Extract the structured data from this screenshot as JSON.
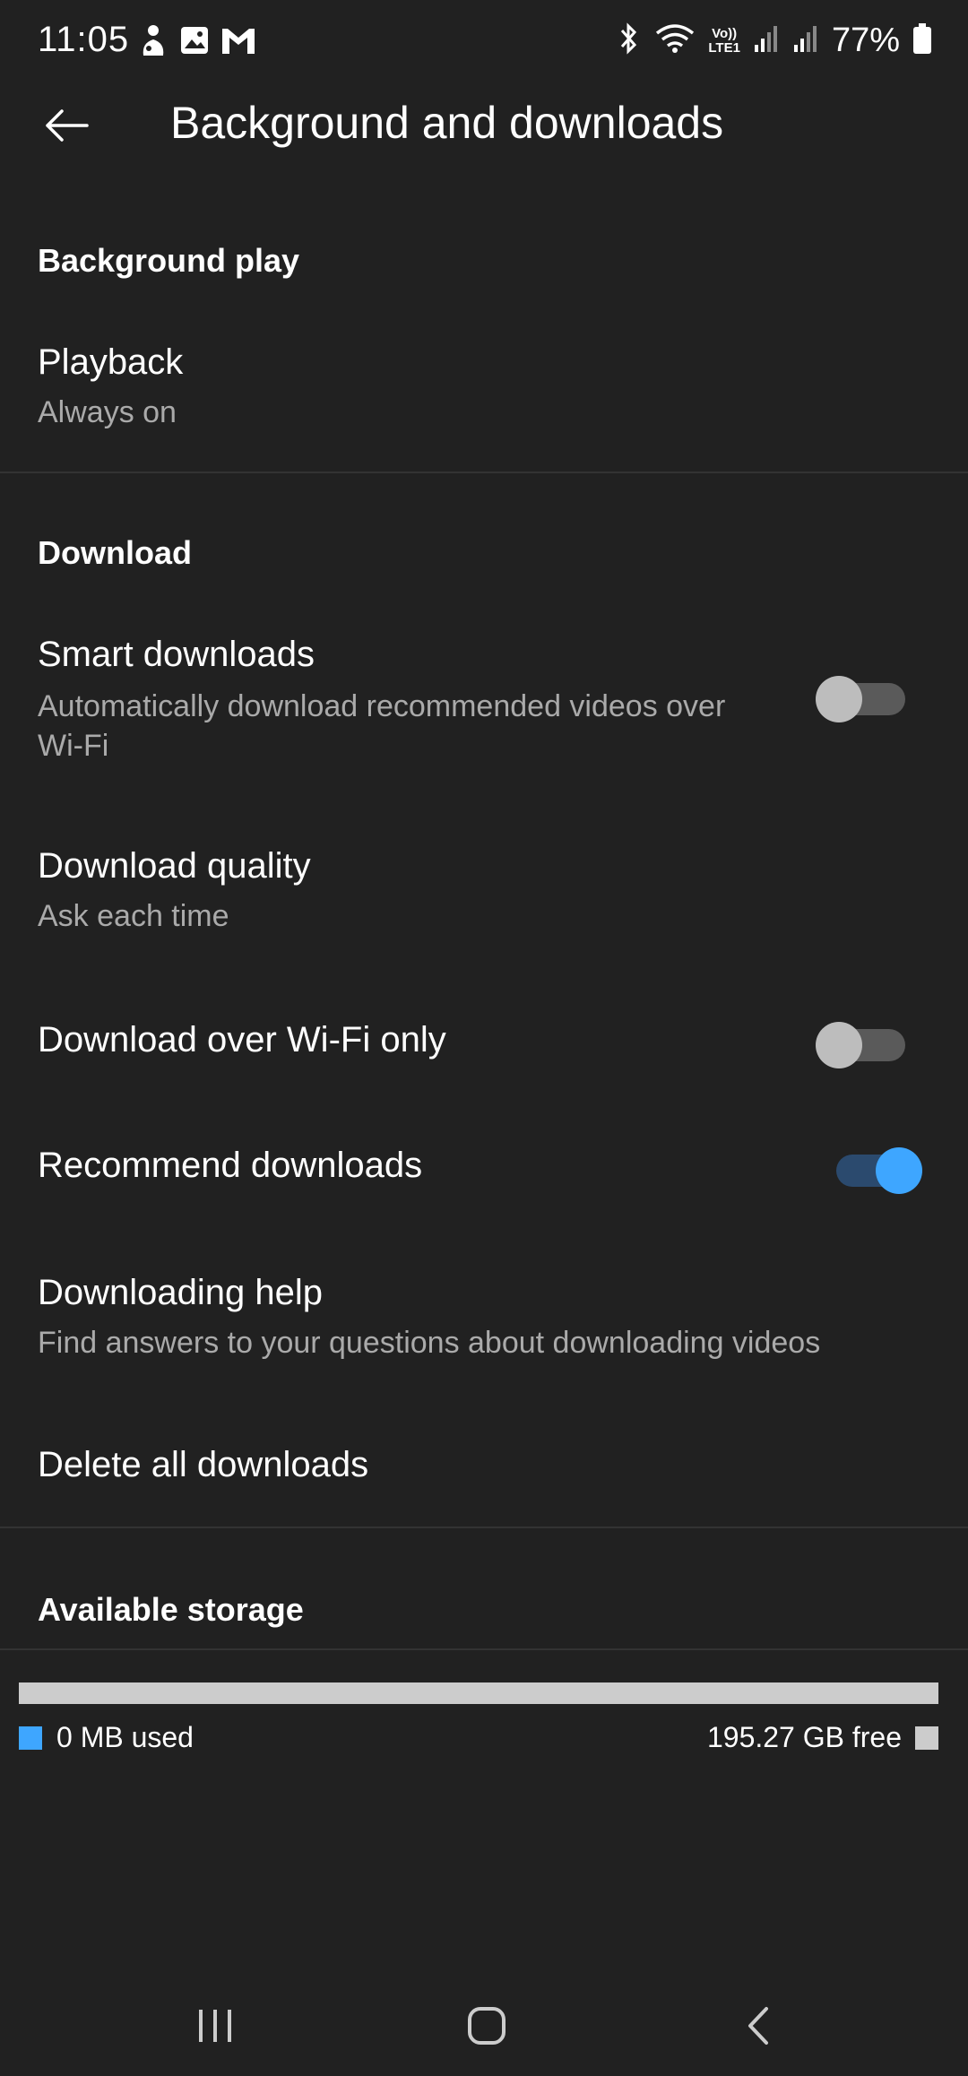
{
  "status_bar": {
    "time": "11:05",
    "battery_percent": "77%",
    "left_icons": [
      "notification-app-icon",
      "gallery-icon",
      "gmail-icon"
    ],
    "right_icons": [
      "bluetooth-icon",
      "wifi-icon",
      "volte-lte-icon",
      "signal-icon",
      "signal-icon",
      "battery-icon"
    ],
    "volte_label": "Vo))",
    "lte_label": "LTE1"
  },
  "app_bar": {
    "title": "Background and downloads"
  },
  "sections": {
    "background_play": {
      "header": "Background play",
      "playback": {
        "title": "Playback",
        "subtitle": "Always on"
      }
    },
    "download": {
      "header": "Download",
      "smart_downloads": {
        "title": "Smart downloads",
        "subtitle": "Automatically download recommended videos over Wi-Fi",
        "enabled": false
      },
      "download_quality": {
        "title": "Download quality",
        "subtitle": "Ask each time"
      },
      "wifi_only": {
        "title": "Download over Wi-Fi only",
        "enabled": false
      },
      "recommend_downloads": {
        "title": "Recommend downloads",
        "enabled": true
      },
      "downloading_help": {
        "title": "Downloading help",
        "subtitle": "Find answers to your questions about downloading videos"
      },
      "delete_all": {
        "title": "Delete all downloads"
      }
    },
    "storage": {
      "header": "Available storage",
      "used_label": "0 MB used",
      "free_label": "195.27 GB free",
      "used_fraction": 0,
      "used_color": "#3ea6ff",
      "free_color": "#cccccc"
    }
  },
  "colors": {
    "background": "#212121",
    "accent": "#3ea6ff",
    "secondary_text": "#aaaaaa"
  }
}
